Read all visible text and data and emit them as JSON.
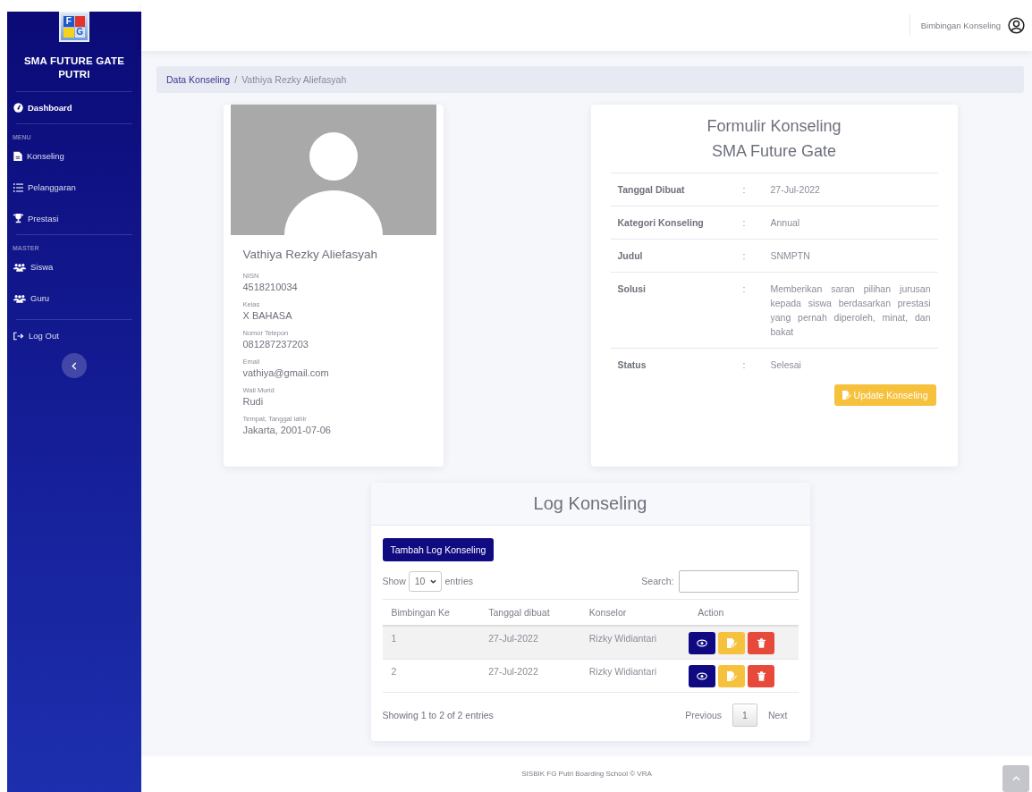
{
  "sidebar": {
    "logo_letters": [
      "F",
      "G"
    ],
    "brand": "SMA FUTURE GATE PUTRI",
    "groups": [
      {
        "items": [
          {
            "label": "Dashboard",
            "selected": true
          }
        ]
      },
      {
        "heading": "MENU",
        "items": [
          {
            "label": "Konseling",
            "selected": false
          },
          {
            "label": "Pelanggaran",
            "selected": false
          },
          {
            "label": "Prestasi",
            "selected": false
          }
        ]
      },
      {
        "heading": "MASTER",
        "items": [
          {
            "label": "Siswa",
            "selected": false
          },
          {
            "label": "Guru",
            "selected": false
          }
        ]
      },
      {
        "items": [
          {
            "label": "Log Out",
            "selected": false
          }
        ]
      }
    ]
  },
  "header": {
    "user": "Bimbingan Konseling"
  },
  "breadcrumb": {
    "items": [
      "Data Konseling",
      "Vathiya Rezky Aliefasyah"
    ],
    "separator": "/"
  },
  "profile": {
    "name": "Vathiya Rezky Aliefasyah",
    "fields": [
      {
        "label": "NISN",
        "value": "4518210034"
      },
      {
        "label": "Kelas",
        "value": "X BAHASA"
      },
      {
        "label": "Nomor Telepon",
        "value": "081287237203"
      },
      {
        "label": "Email",
        "value": "vathiya@gmail.com"
      },
      {
        "label": "Wali Murid",
        "value": "Rudi"
      },
      {
        "label": "Tempat, Tanggal lahir",
        "value": "Jakarta, 2001-07-06"
      }
    ]
  },
  "form": {
    "title": [
      "Formulir Konseling",
      "SMA Future Gate"
    ],
    "separator": ":",
    "rows": [
      {
        "label": "Tanggal Dibuat",
        "value": "27-Jul-2022"
      },
      {
        "label": "Kategori Konseling",
        "value": "Annual"
      },
      {
        "label": "Judul",
        "value": "SNMPTN"
      },
      {
        "label": "Solusi",
        "value": "Memberikan saran pilihan jurusan kepada siswa berdasarkan prestasi yang pernah diperoleh, minat, dan bakat"
      },
      {
        "label": "Status",
        "value": "Selesai"
      }
    ],
    "button": "Update Konseling"
  },
  "log": {
    "title": "Log Konseling",
    "add_button": "Tambah Log Konseling",
    "show_label": "Show",
    "page_size": "10",
    "entries_label": "entries",
    "search_label": "Search:",
    "columns": [
      "Bimbingan Ke",
      "Tanggal dibuat",
      "Konselor",
      "Action"
    ],
    "rows": [
      {
        "cells": [
          "1",
          "27-Jul-2022",
          "Rizky Widiantari"
        ]
      },
      {
        "cells": [
          "2",
          "27-Jul-2022",
          "Rizky Widiantari"
        ]
      }
    ],
    "info": "Showing 1 to 2 of 2 entries",
    "pagination": {
      "previous": "Previous",
      "pages": [
        {
          "label": "1",
          "selected": true
        }
      ],
      "next": "Next"
    }
  },
  "footer": "SISBIK FG Putri Boarding School © VRA"
}
